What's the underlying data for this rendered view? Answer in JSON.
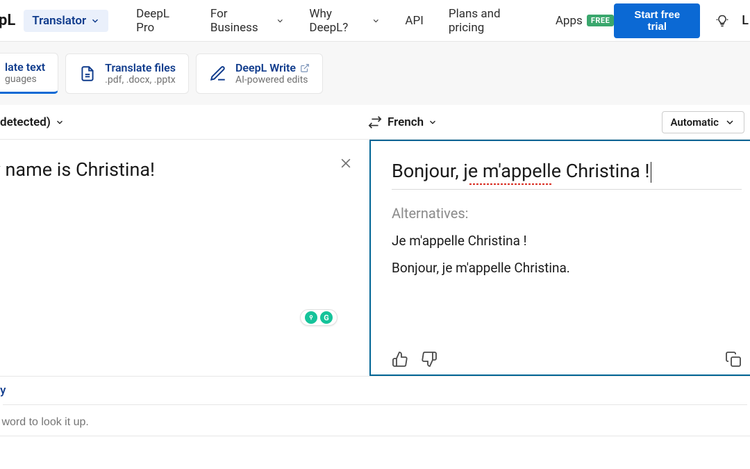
{
  "header": {
    "logo_fragment": "pL",
    "product_dropdown_label": "Translator",
    "nav": {
      "deepl_pro": "DeepL Pro",
      "for_business": "For Business",
      "why_deepl": "Why DeepL?",
      "api": "API",
      "plans": "Plans and pricing",
      "apps": "Apps",
      "apps_badge": "FREE"
    },
    "cta_label": "Start free trial",
    "login_fragment": "L"
  },
  "modes": {
    "translate_text": {
      "title": "late text",
      "sub": "guages"
    },
    "translate_files": {
      "title": "Translate files",
      "sub": ".pdf, .docx, .pptx"
    },
    "write": {
      "title": "DeepL Write",
      "sub": "AI-powered edits"
    }
  },
  "lang": {
    "source_label": "detected)",
    "target_label": "French",
    "auto_label": "Automatic"
  },
  "translation": {
    "source_text": "y name is Christina!",
    "target_text": "Bonjour, je m'appelle Christina !",
    "alternatives_label": "Alternatives:",
    "alternatives": [
      "Je m'appelle Christina !",
      "Bonjour, je m'appelle Christina."
    ]
  },
  "dictionary": {
    "title_fragment": "ry",
    "placeholder": " word to look it up."
  }
}
